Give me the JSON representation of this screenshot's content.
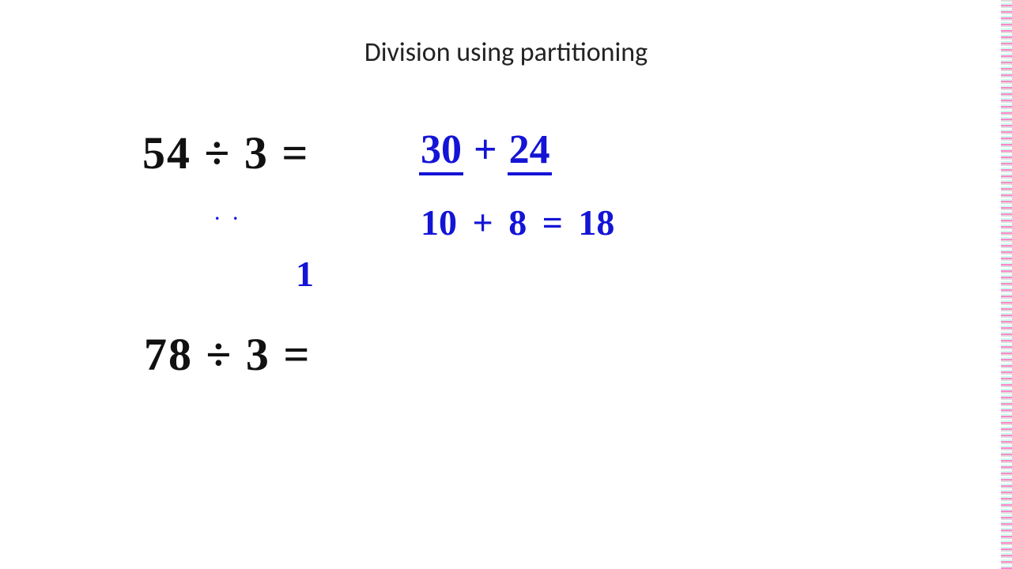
{
  "title": "Division using partitioning",
  "problem1": {
    "expression": "54 ÷ 3 =",
    "partition_a": "30",
    "partition_plus": "+",
    "partition_b": "24",
    "quotient_line": "10  +   8   =   18",
    "stray_dots": ". .",
    "stray_stroke": "1"
  },
  "problem2": {
    "expression": "78 ÷ 3 ="
  }
}
